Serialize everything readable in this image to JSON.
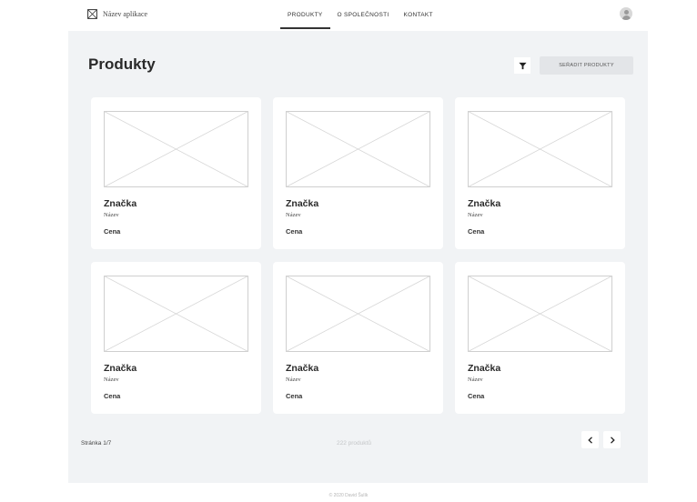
{
  "header": {
    "app_name": "Název aplikace",
    "app_icon": "image-placeholder-icon",
    "nav": [
      {
        "label": "PRODUKTY",
        "active": true
      },
      {
        "label": "O SPOLEČNOSTI",
        "active": false
      },
      {
        "label": "KONTAKT",
        "active": false
      }
    ],
    "avatar_icon": "user-avatar-icon"
  },
  "main": {
    "title": "Produkty",
    "filter_icon": "filter-icon",
    "sort_label": "SEŘADIT PRODUKTY",
    "products": [
      {
        "brand": "Značka",
        "name": "Název",
        "price": "Cena"
      },
      {
        "brand": "Značka",
        "name": "Název",
        "price": "Cena"
      },
      {
        "brand": "Značka",
        "name": "Název",
        "price": "Cena"
      },
      {
        "brand": "Značka",
        "name": "Název",
        "price": "Cena"
      },
      {
        "brand": "Značka",
        "name": "Název",
        "price": "Cena"
      },
      {
        "brand": "Značka",
        "name": "Název",
        "price": "Cena"
      }
    ],
    "page_info": "Stránka 1/7",
    "count_info": "222 produktů",
    "prev_icon": "chevron-left-icon",
    "next_icon": "chevron-right-icon"
  },
  "footer": {
    "text": "© 2020 David Šulík"
  },
  "colors": {
    "panel_bg": "#f1f3f5",
    "card_bg": "#ffffff",
    "sort_button_bg": "#e3e5e8"
  }
}
